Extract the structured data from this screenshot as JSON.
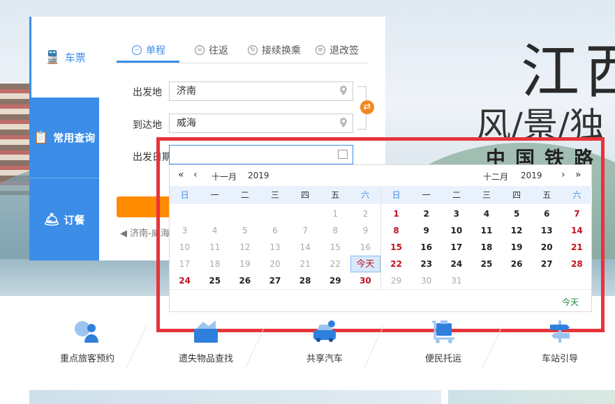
{
  "hero": {
    "title_main": "江西",
    "title_sub": "风/景/独",
    "title_cn": "中国铁路"
  },
  "sidenav": {
    "ticket": "车票",
    "query": "常用查询",
    "meal": "订餐"
  },
  "tabs": {
    "oneway": "单程",
    "round": "往返",
    "transfer": "接续换乘",
    "change": "退改签"
  },
  "form": {
    "from_label": "出发地",
    "from_value": "济南",
    "to_label": "到达地",
    "to_value": "威海",
    "date_label": "出发日期",
    "date_value": "",
    "history": "济南-威海"
  },
  "calendar": {
    "left": {
      "month": "十一月",
      "year": "2019",
      "weekdays": [
        "日",
        "一",
        "二",
        "三",
        "四",
        "五",
        "六"
      ],
      "leading_blanks": 5,
      "days": [
        "1",
        "2",
        "3",
        "4",
        "5",
        "6",
        "7",
        "8",
        "9",
        "10",
        "11",
        "12",
        "13",
        "14",
        "15",
        "16",
        "17",
        "18",
        "19",
        "20",
        "21",
        "22",
        "23",
        "24",
        "25",
        "26",
        "27",
        "28",
        "29",
        "30"
      ],
      "today": "今天",
      "today_index": 22
    },
    "right": {
      "month": "十二月",
      "year": "2019",
      "weekdays": [
        "日",
        "一",
        "二",
        "三",
        "四",
        "五",
        "六"
      ],
      "leading_blanks": 0,
      "days": [
        "1",
        "2",
        "3",
        "4",
        "5",
        "6",
        "7",
        "8",
        "9",
        "10",
        "11",
        "12",
        "13",
        "14",
        "15",
        "16",
        "17",
        "18",
        "19",
        "20",
        "21",
        "22",
        "23",
        "24",
        "25",
        "26",
        "27",
        "28",
        "29",
        "30",
        "31"
      ]
    },
    "footer_today": "今天",
    "colors": {
      "red": "#c1121f",
      "accent": "#3b8de8",
      "frame": "#e8333a"
    }
  },
  "services": [
    {
      "label": "重点旅客预约",
      "icon": "passenger-icon"
    },
    {
      "label": "遗失物品查找",
      "icon": "lost-found-icon"
    },
    {
      "label": "共享汽车",
      "icon": "car-share-icon"
    },
    {
      "label": "便民托运",
      "icon": "luggage-cart-icon"
    },
    {
      "label": "车站引导",
      "icon": "signpost-icon"
    }
  ]
}
